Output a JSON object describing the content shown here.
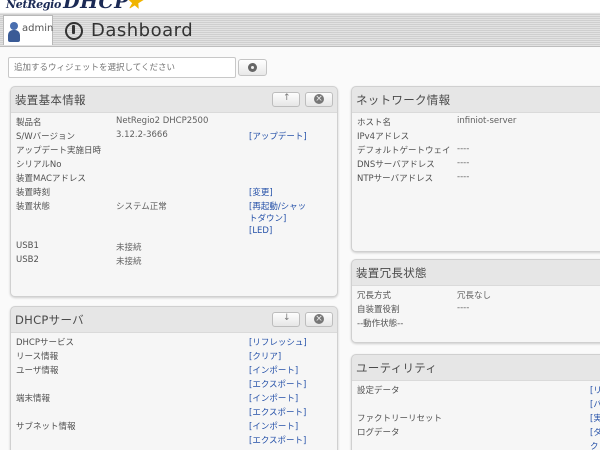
{
  "header": {
    "logo_small": "NetRegio",
    "logo_large": "DHCP",
    "user_label": "admin",
    "page_title": "Dashboard"
  },
  "widget_bar": {
    "placeholder": "追加するウィジェットを選択してください"
  },
  "device_info": {
    "title": "装置基本情報",
    "rows": [
      {
        "label": "製品名",
        "value": "NetRegio2 DHCP2500",
        "link": ""
      },
      {
        "label": "S/Wバージョン",
        "value": "3.12.2-3666",
        "link": "[アップデート]"
      },
      {
        "label": "アップデート実施日時",
        "value": "",
        "link": ""
      },
      {
        "label": "シリアルNo",
        "value": "",
        "link": ""
      },
      {
        "label": "装置MACアドレス",
        "value": "",
        "link": ""
      },
      {
        "label": "装置時刻",
        "value": "",
        "link": "[変更]"
      },
      {
        "label": "装置状態",
        "value": "システム正常",
        "link": "[再起動/シャッ"
      },
      {
        "label": "",
        "value": "",
        "link": "トダウン]"
      },
      {
        "label": "",
        "value": "",
        "link": "[LED]"
      },
      {
        "label": "USB1",
        "value": "未接続",
        "link": ""
      },
      {
        "label": "USB2",
        "value": "未接続",
        "link": ""
      }
    ]
  },
  "network_info": {
    "title": "ネットワーク情報",
    "rows": [
      {
        "label": "ホスト名",
        "value": "infiniot-server"
      },
      {
        "label": "IPv4アドレス",
        "value": ""
      },
      {
        "label": "デフォルトゲートウェイ",
        "value": "----"
      },
      {
        "label": "DNSサーバアドレス",
        "value": "----"
      },
      {
        "label": "NTPサーバアドレス",
        "value": "----"
      }
    ]
  },
  "dhcp_server": {
    "title": "DHCPサーバ",
    "rows": [
      {
        "label": "DHCPサービス",
        "links": [
          "[リフレッシュ]"
        ]
      },
      {
        "label": "リース情報",
        "links": [
          "[クリア]"
        ]
      },
      {
        "label": "ユーザ情報",
        "links": [
          "[インポート]",
          "[エクスポート]"
        ]
      },
      {
        "label": "端末情報",
        "links": [
          "[インポート]",
          "[エクスポート]"
        ]
      },
      {
        "label": "サブネット情報",
        "links": [
          "[インポート]",
          "[エクスポート]"
        ]
      }
    ]
  },
  "redundancy": {
    "title": "装置冗長状態",
    "rows": [
      {
        "label": "冗長方式",
        "value": "冗長なし"
      },
      {
        "label": "自装置役割",
        "value": "----"
      },
      {
        "label": "--動作状態--",
        "value": ""
      }
    ]
  },
  "utility": {
    "title": "ユーティリティ",
    "rows": [
      {
        "label": "設定データ",
        "links": [
          "[リ",
          "[バ"
        ]
      },
      {
        "label": "ファクトリーリセット",
        "links": [
          "[実"
        ]
      },
      {
        "label": "ログデータ",
        "links": [
          "[ダ",
          "ク"
        ]
      }
    ]
  }
}
